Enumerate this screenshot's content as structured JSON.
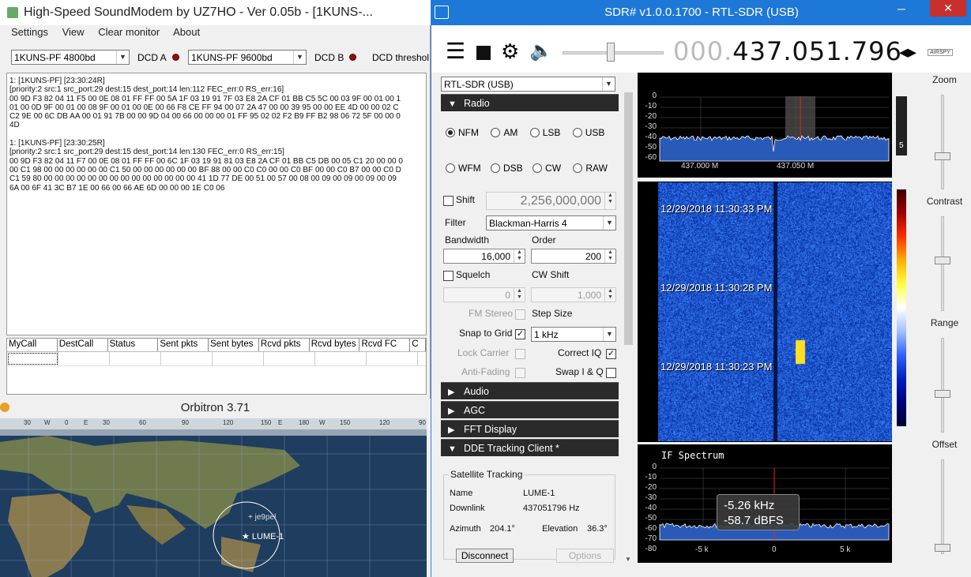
{
  "soundmodem": {
    "title": "High-Speed SoundModem by UZ7HO - Ver 0.05b - [1KUNS-...",
    "menu": [
      "Settings",
      "View",
      "Clear monitor",
      "About"
    ],
    "modem_a": "1KUNS-PF 4800bd",
    "dcd_a": "DCD A",
    "modem_b": "1KUNS-PF 9600bd",
    "dcd_b": "DCD B",
    "dcd_threshold": "DCD threshol",
    "monitor_text": "1: [1KUNS-PF] [23:30:24R]\n[priority:2 src:1 src_port:29 dest:15 dest_port:14 len:112 FEC_err:0 RS_err:16]\n00 9D F3 82 04 11 F5 00 0E 08 01 FF FF 00 5A 1F 03 19 91 7F 03 E8 2A CF 01 BB C5 5C 00 03 9F 00 01 00 1\n01 00 0D 9F 00 01 00 08 9F 00 01 00 0E 00 66 F8 CE FF 94 00 07 2A 47 00 00 39 95 00 00 EE 4D 00 00 02 C\nC2 9E 00 6C DB AA 00 01 91 7B 00 00 9D 04 00 66 00 00 00 01 FF 95 02 02 F2 B9 FF B2 98 06 72 5F 00 00 0\n4D\n\n1: [1KUNS-PF] [23:30:25R]\n[priority:2 src:1 src_port:29 dest:15 dest_port:14 len:130 FEC_err:0 RS_err:15]\n00 9D F3 82 04 11 F7 00 0E 08 01 FF FF 00 6C 1F 03 19 91 81 03 E8 2A CF 01 BB C5 DB 00 05 C1 20 00 00 0\n00 C1 98 00 00 00 00 00 00 C1 50 00 00 00 00 00 00 BF 88 00 00 C0 C0 00 00 C0 BF 00 00 C0 B7 00 00 C0 D\nC1 59 80 00 00 00 00 00 00 00 00 00 00 00 00 00 00 41 1D 77 DE 00 51 00 57 00 08 00 09 00 09 00 09 00 09\n6A 00 6F 41 3C B7 1E 00 66 00 66 AE 6D 00 00 00 1E C0 06",
    "table_headers": [
      "MyCall",
      "DestCall",
      "Status",
      "Sent pkts",
      "Sent bytes",
      "Rcvd pkts",
      "Rcvd bytes",
      "Rcvd FC",
      "C"
    ]
  },
  "orbitron": {
    "title": "Orbitron 3.71",
    "lon_labels": [
      "30",
      "W",
      "0",
      "E",
      "30",
      "60",
      "90",
      "120",
      "150",
      "E",
      "180",
      "W",
      "150",
      "120",
      "90"
    ],
    "ground_station": "+ je9pel",
    "satellite": "★ LUME-1"
  },
  "sdr": {
    "title": "SDR# v1.0.0.1700 - RTL-SDR (USB)",
    "freq_dim": "000.",
    "freq_main": "437.051.796",
    "logo": "AIRSPY",
    "device": "RTL-SDR (USB)",
    "radio_section": "Radio",
    "modes_row1": [
      "NFM",
      "AM",
      "LSB",
      "USB"
    ],
    "modes_row2": [
      "WFM",
      "DSB",
      "CW",
      "RAW"
    ],
    "selected_mode": "NFM",
    "shift_label": "Shift",
    "shift_value": "2,256,000,000",
    "filter_label": "Filter",
    "filter_value": "Blackman-Harris 4",
    "bandwidth_label": "Bandwidth",
    "bandwidth_value": "16,000",
    "order_label": "Order",
    "order_value": "200",
    "squelch_label": "Squelch",
    "squelch_value": "0",
    "cwshift_label": "CW Shift",
    "cwshift_value": "1,000",
    "fmstereo_label": "FM Stereo",
    "stepsize_label": "Step Size",
    "snap_label": "Snap to Grid",
    "step_value": "1 kHz",
    "lockcarrier_label": "Lock Carrier",
    "correctiq_label": "Correct IQ",
    "antifading_label": "Anti-Fading",
    "swapiq_label": "Swap I & Q",
    "sections": [
      "Audio",
      "AGC",
      "FFT Display",
      "DDE Tracking Client *"
    ],
    "tracking": {
      "group": "Satellite Tracking",
      "name_label": "Name",
      "name_value": "LUME-1",
      "downlink_label": "Downlink",
      "downlink_value": "437051796 Hz",
      "azimuth_label": "Azimuth",
      "azimuth_value": "204.1°",
      "elevation_label": "Elevation",
      "elevation_value": "36.3°",
      "disconnect": "Disconnect",
      "options": "Options"
    },
    "spectrum": {
      "y_ticks": [
        "0",
        "-10",
        "-20",
        "-30",
        "-40",
        "-50",
        "-60"
      ],
      "x_ticks": [
        "437.000 M",
        "437.050 M"
      ],
      "bar_value": "5"
    },
    "waterfall_times": [
      "12/29/2018 11:30:33 PM",
      "12/29/2018 11:30:28 PM",
      "12/29/2018 11:30:23 PM"
    ],
    "if_spectrum": {
      "title": "IF Spectrum",
      "y_ticks": [
        "0",
        "-10",
        "-20",
        "-30",
        "-40",
        "-50",
        "-60",
        "-70",
        "-80"
      ],
      "x_ticks": [
        "-5 k",
        "0",
        "5 k"
      ],
      "tooltip_freq": "-5.26 kHz",
      "tooltip_level": "-58.7 dBFS"
    },
    "slider_labels": [
      "Zoom",
      "Contrast",
      "Range",
      "Offset"
    ]
  }
}
